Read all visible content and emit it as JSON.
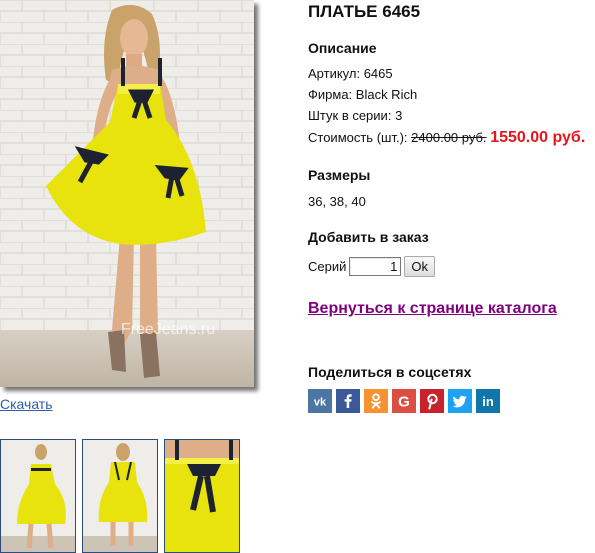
{
  "product": {
    "title": "ПЛАТЬЕ 6465",
    "watermark": "FreeJeans.ru",
    "download_label": "Скачать"
  },
  "description": {
    "heading": "Описание",
    "article_label": "Артикул:",
    "article_value": "6465",
    "brand_label": "Фирма:",
    "brand_value": "Black Rich",
    "pieces_label": "Штук в серии:",
    "pieces_value": "3",
    "price_label": "Стоимость (шт.):",
    "price_old": "2400.00 руб.",
    "price_new": "1550.00 руб."
  },
  "sizes": {
    "heading": "Размеры",
    "values": "36, 38, 40"
  },
  "order": {
    "heading": "Добавить в заказ",
    "series_label": "Серий",
    "quantity": "1",
    "ok_label": "Ok"
  },
  "catalog_link": "Вернуться к странице каталога",
  "share": {
    "heading": "Поделиться в соцсетях",
    "buttons": [
      {
        "name": "vk-icon",
        "color": "#4c75a3"
      },
      {
        "name": "facebook-icon",
        "color": "#3b5998"
      },
      {
        "name": "odnoklassniki-icon",
        "color": "#f59331"
      },
      {
        "name": "google-plus-icon",
        "color": "#dc4e41"
      },
      {
        "name": "pinterest-icon",
        "color": "#c8232c"
      },
      {
        "name": "twitter-icon",
        "color": "#1da1f2"
      },
      {
        "name": "linkedin-icon",
        "color": "#0e76a8"
      }
    ]
  },
  "colors": {
    "dress": "#e8e30c",
    "price_new": "#e8141c",
    "visited_link": "#800080",
    "link": "#2a5db0"
  }
}
